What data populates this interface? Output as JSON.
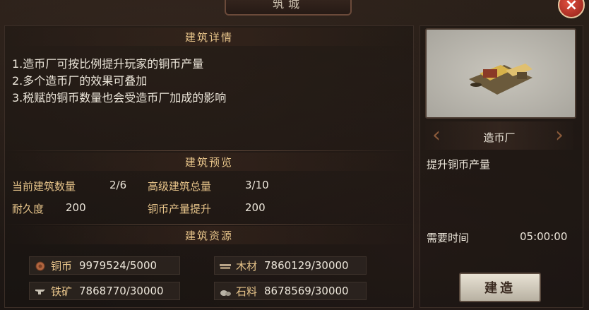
{
  "window": {
    "title": "筑城",
    "close_label": "×"
  },
  "details": {
    "header": "建筑详情",
    "lines": [
      "1.造币厂可按比例提升玩家的铜币产量",
      "2.多个造币厂的效果可叠加",
      "3.税赋的铜币数量也会受造币厂加成的影响"
    ]
  },
  "preview_section": {
    "header": "建筑预览",
    "stats": [
      {
        "label": "当前建筑数量",
        "value": "2/6"
      },
      {
        "label": "高级建筑总量",
        "value": "3/10"
      },
      {
        "label": "耐久度",
        "value": "200"
      },
      {
        "label": "铜币产量提升",
        "value": "200"
      }
    ]
  },
  "resources": {
    "header": "建筑资源",
    "items": [
      {
        "name": "铜币",
        "value": "9979524/5000",
        "icon": "copper-coin-icon"
      },
      {
        "name": "木材",
        "value": "7860129/30000",
        "icon": "wood-icon"
      },
      {
        "name": "铁矿",
        "value": "7868770/30000",
        "icon": "iron-ore-icon"
      },
      {
        "name": "石料",
        "value": "8678569/30000",
        "icon": "stone-icon"
      }
    ]
  },
  "building": {
    "name": "造币厂",
    "effect": "提升铜币产量",
    "time_label": "需要时间",
    "time_value": "05:00:00",
    "build_label": "建造"
  },
  "colors": {
    "accent_gold": "#e7c48a",
    "text": "#ece6da",
    "close_red": "#c0392b"
  }
}
